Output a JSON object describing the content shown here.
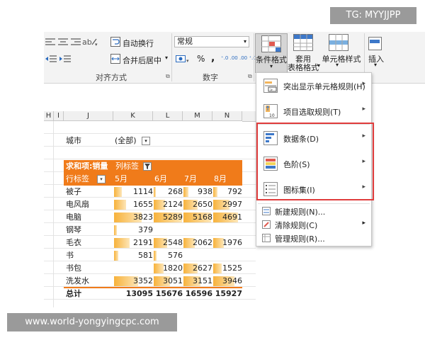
{
  "watermark_top": "TG: MYYJJPP",
  "watermark_bottom": "www.world-yongyingcpc.com",
  "ribbon": {
    "wrap_text": "自动换行",
    "merge_center": "合并后居中",
    "merge_arrow": "▾",
    "align_group": "对齐方式",
    "number_format": "常规",
    "percent": "%",
    "comma": ",",
    "inc_decimal": "⁺.0 .00",
    "dec_decimal": ".00 ⁺.0",
    "number_group": "数字",
    "conditional_format": "条件格式",
    "cond_arrow": "▾",
    "table_format_1": "套用",
    "table_format_2": "表格格式",
    "table_arrow": "▾",
    "cell_style_1": "单元格样式",
    "cell_style_arrow": "▾",
    "insert": "插入",
    "insert_arrow": "▾",
    "dialog_launcher": "⧉"
  },
  "columns": [
    "H",
    "I",
    "J",
    "K",
    "L",
    "M",
    "N"
  ],
  "pivot": {
    "filter_label": "城市",
    "filter_value": "(全部)",
    "sum_label": "求和项:销量",
    "col_label": "列标签",
    "row_label": "行标签",
    "months": [
      "5月",
      "6月",
      "7月",
      "8月"
    ],
    "rows": [
      {
        "name": "被子",
        "values": [
          "1114",
          "268",
          "938",
          "792"
        ]
      },
      {
        "name": "电风扇",
        "values": [
          "1655",
          "2124",
          "2650",
          "2997"
        ]
      },
      {
        "name": "电脑",
        "values": [
          "3823",
          "5289",
          "5168",
          "4691"
        ]
      },
      {
        "name": "钢琴",
        "values": [
          "379",
          "",
          "",
          ""
        ]
      },
      {
        "name": "毛衣",
        "values": [
          "2191",
          "2548",
          "2062",
          "1976"
        ]
      },
      {
        "name": "书",
        "values": [
          "581",
          "576",
          "",
          ""
        ]
      },
      {
        "name": "书包",
        "values": [
          "",
          "1820",
          "2627",
          "1525"
        ]
      },
      {
        "name": "洗发水",
        "values": [
          "3352",
          "3051",
          "3151",
          "3946"
        ]
      }
    ],
    "total_label": "总计",
    "totals": [
      "13095",
      "15676",
      "16596",
      "15927"
    ]
  },
  "menu": {
    "items": [
      {
        "label": "突出显示单元格规则(H)",
        "arrow": "▸"
      },
      {
        "label": "项目选取规则(T)",
        "arrow": "▸"
      },
      {
        "label": "数据条(D)",
        "arrow": "▸"
      },
      {
        "label": "色阶(S)",
        "arrow": "▸"
      },
      {
        "label": "图标集(I)",
        "arrow": "▸"
      }
    ],
    "small_items": [
      {
        "label": "新建规则(N)...",
        "arrow": ""
      },
      {
        "label": "清除规则(C)",
        "arrow": "▸"
      },
      {
        "label": "管理规则(R)...",
        "arrow": ""
      }
    ],
    "icon_ten": "10",
    "highlight_color": "#e03c3c"
  }
}
